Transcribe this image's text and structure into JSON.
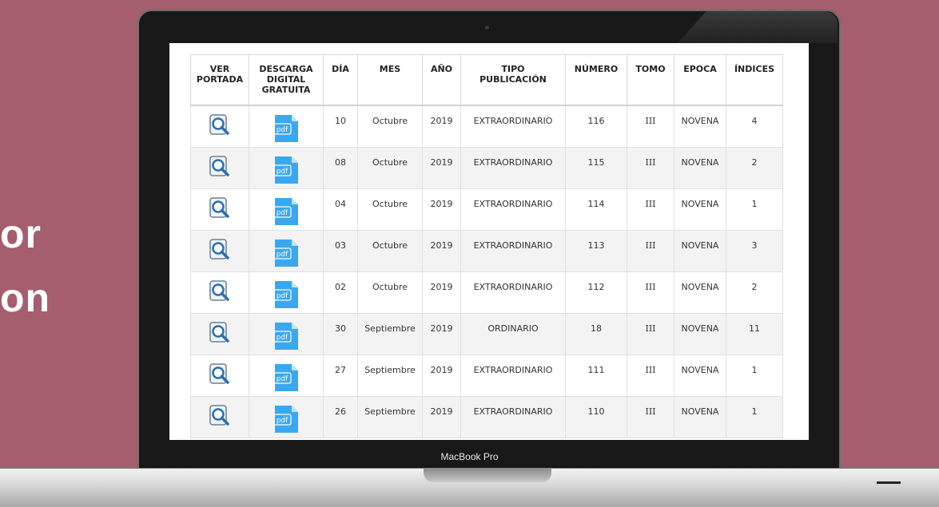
{
  "side_text": [
    "or",
    "on"
  ],
  "brand": "MacBook Pro",
  "table": {
    "headers": {
      "ver_portada": [
        "VER",
        "PORTADA"
      ],
      "descarga": [
        "DESCARGA",
        "DIGITAL",
        "GRATUITA"
      ],
      "dia": "DÍA",
      "mes": "MES",
      "anio": "AÑO",
      "tipo": [
        "TIPO",
        "PUBLICACIÓN"
      ],
      "numero": "NÚMERO",
      "tomo": "TOMO",
      "epoca": "EPOCA",
      "indices": "ÍNDICES"
    },
    "pdf_label": "pdf",
    "rows": [
      {
        "dia": "10",
        "mes": "Octubre",
        "anio": "2019",
        "tipo": "EXTRAORDINARIO",
        "numero": "116",
        "tomo": "III",
        "epoca": "NOVENA",
        "indices": "4"
      },
      {
        "dia": "08",
        "mes": "Octubre",
        "anio": "2019",
        "tipo": "EXTRAORDINARIO",
        "numero": "115",
        "tomo": "III",
        "epoca": "NOVENA",
        "indices": "2"
      },
      {
        "dia": "04",
        "mes": "Octubre",
        "anio": "2019",
        "tipo": "EXTRAORDINARIO",
        "numero": "114",
        "tomo": "III",
        "epoca": "NOVENA",
        "indices": "1"
      },
      {
        "dia": "03",
        "mes": "Octubre",
        "anio": "2019",
        "tipo": "EXTRAORDINARIO",
        "numero": "113",
        "tomo": "III",
        "epoca": "NOVENA",
        "indices": "3"
      },
      {
        "dia": "02",
        "mes": "Octubre",
        "anio": "2019",
        "tipo": "EXTRAORDINARIO",
        "numero": "112",
        "tomo": "III",
        "epoca": "NOVENA",
        "indices": "2"
      },
      {
        "dia": "30",
        "mes": "Septiembre",
        "anio": "2019",
        "tipo": "ORDINARIO",
        "numero": "18",
        "tomo": "III",
        "epoca": "NOVENA",
        "indices": "11"
      },
      {
        "dia": "27",
        "mes": "Septiembre",
        "anio": "2019",
        "tipo": "EXTRAORDINARIO",
        "numero": "111",
        "tomo": "III",
        "epoca": "NOVENA",
        "indices": "1"
      },
      {
        "dia": "26",
        "mes": "Septiembre",
        "anio": "2019",
        "tipo": "EXTRAORDINARIO",
        "numero": "110",
        "tomo": "III",
        "epoca": "NOVENA",
        "indices": "1"
      }
    ]
  },
  "colors": {
    "background": "#a55e6d",
    "pdf_blue": "#3aa8f0",
    "row_alt": "#f3f3f3"
  },
  "icons": {
    "view": "magnifier-icon",
    "download": "pdf-icon"
  }
}
